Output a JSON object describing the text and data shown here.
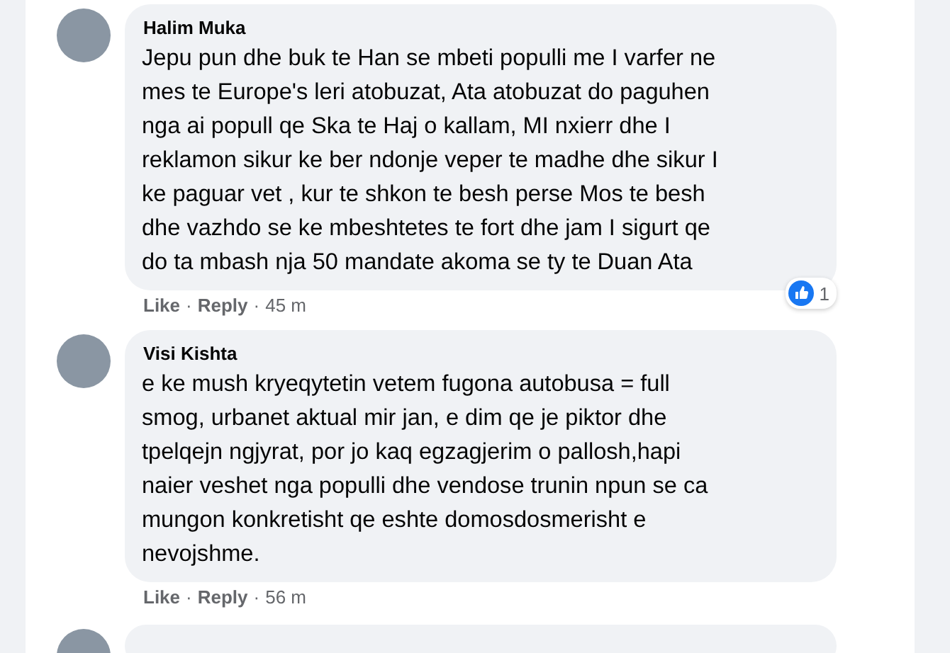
{
  "comments": [
    {
      "author": "Halim Muka",
      "text": "Jepu pun dhe buk te Han se mbeti populli me I varfer ne\nmes te Europe's leri atobuzat, Ata atobuzat do paguhen\nnga ai popull qe Ska te Haj o kallam, MI nxierr dhe I\nreklamon sikur ke ber ndonje veper te madhe dhe sikur I\nke paguar vet , kur te shkon te besh perse Mos te besh\ndhe vazhdo se ke mbeshtetes te fort dhe jam I sigurt qe\ndo ta mbash nja 50 mandate akoma se ty te Duan Ata",
      "actions": [
        "Like",
        "Reply"
      ],
      "separator": "·",
      "time": "45 m",
      "reactions": {
        "count": "1"
      }
    },
    {
      "author": "Visi Kishta",
      "text": "e ke mush kryeqytetin vetem fugona autobusa = full\nsmog, urbanet aktual mir jan, e dim qe je piktor dhe\ntpelqejn ngjyrat, por jo kaq egzagjerim o pallosh,hapi\nnaier veshet nga populli dhe vendose trunin npun se ca\nmungon konkretisht qe eshte domosdosmerisht e\nnevojshme.",
      "actions": [
        "Like",
        "Reply"
      ],
      "separator": "·",
      "time": "56 m"
    }
  ]
}
